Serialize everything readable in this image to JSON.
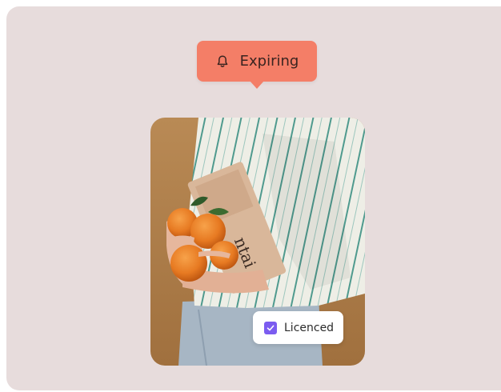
{
  "tooltip": {
    "icon": "bell-icon",
    "label": "Expiring",
    "color": "#f47e67"
  },
  "photo": {
    "description_icon": "photo-image"
  },
  "chip": {
    "icon": "checkbox-checked-icon",
    "label": "Licenced",
    "checked": true,
    "accent": "#7b5cf0"
  },
  "colors": {
    "background": "#e7dcdc"
  }
}
